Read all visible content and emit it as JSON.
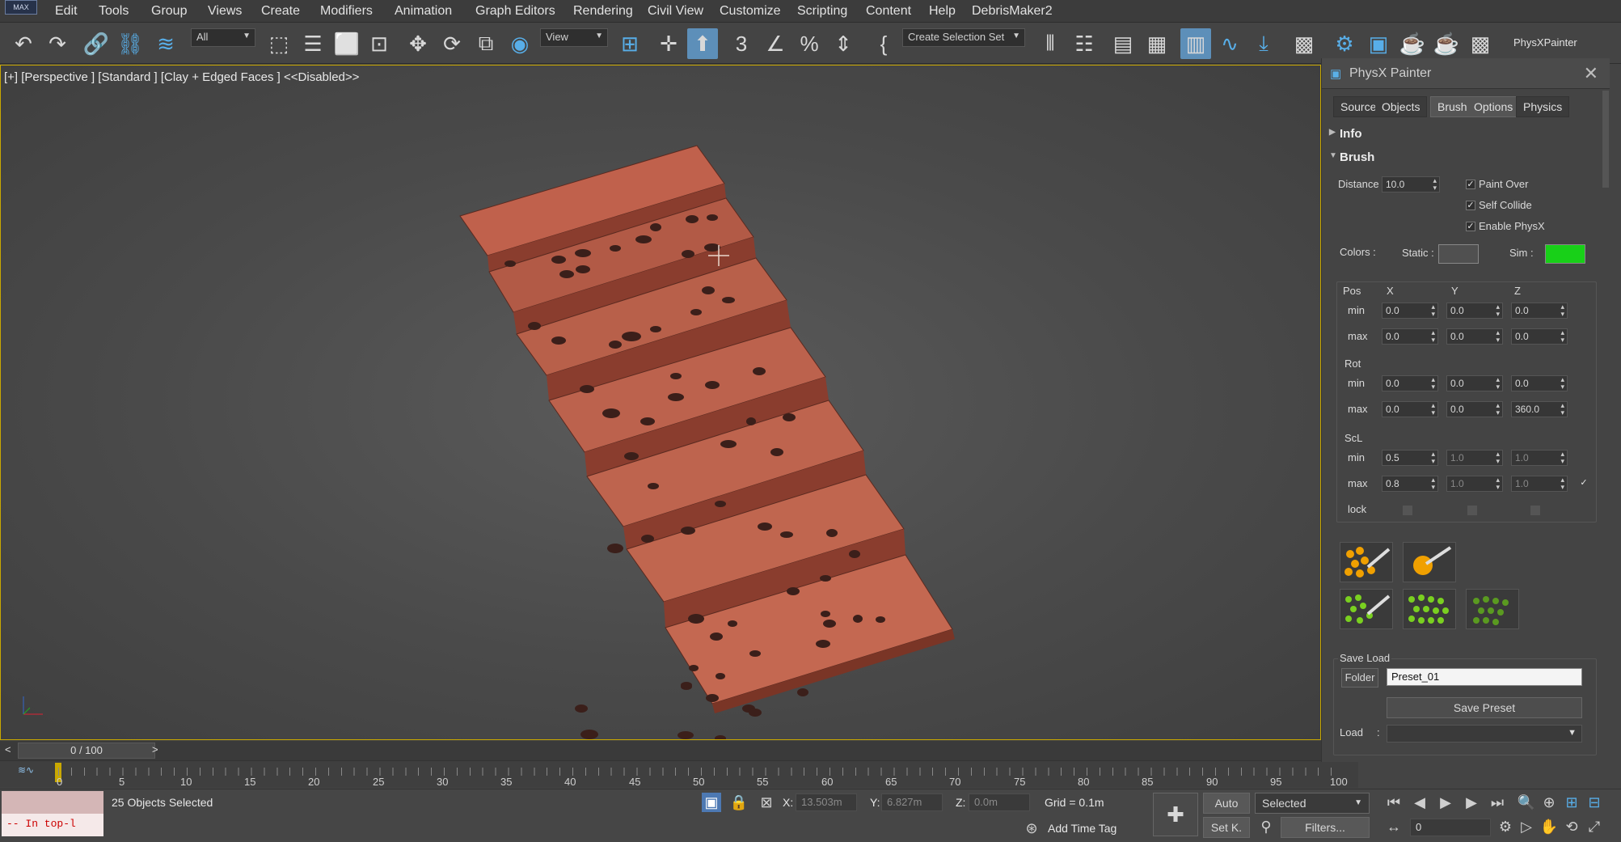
{
  "app": {
    "logo": "MAX"
  },
  "menu": [
    "Edit",
    "Tools",
    "Group",
    "Views",
    "Create",
    "Modifiers",
    "Animation",
    "Graph Editors",
    "Rendering",
    "Civil View",
    "Customize",
    "Scripting",
    "Content",
    "Help",
    "DebrisMaker2"
  ],
  "toolbar": {
    "filter": "All",
    "refcoord": "View",
    "selection_set": "Create Selection Set",
    "plugin_label": "PhysXPainter"
  },
  "viewport": {
    "label": "[+] [Perspective ] [Standard ] [Clay + Edged Faces ] <<Disabled>>"
  },
  "panel": {
    "title": "PhysX Painter",
    "tabs": [
      "Source",
      "Objects",
      "Brush",
      "Options",
      "Physics"
    ],
    "rollouts": {
      "info": "Info",
      "brush": "Brush"
    },
    "distance": {
      "label": "Distance",
      "value": "10.0"
    },
    "checks": [
      {
        "label": "Paint Over",
        "checked": true
      },
      {
        "label": "Self Collide",
        "checked": true
      },
      {
        "label": "Enable PhysX",
        "checked": true
      }
    ],
    "colors": {
      "label": "Colors :",
      "static_label": "Static :",
      "sim_label": "Sim :",
      "static_color": "#505050",
      "sim_color": "#18d018"
    },
    "axes": [
      "X",
      "Y",
      "Z"
    ],
    "groups": {
      "pos": "Pos",
      "rot": "Rot",
      "scl": "ScL"
    },
    "minmax": {
      "min": "min",
      "max": "max",
      "lock": "lock"
    },
    "pos": {
      "min": [
        "0.0",
        "0.0",
        "0.0"
      ],
      "max": [
        "0.0",
        "0.0",
        "0.0"
      ]
    },
    "rot": {
      "min": [
        "0.0",
        "0.0",
        "0.0"
      ],
      "max": [
        "0.0",
        "0.0",
        "360.0"
      ]
    },
    "scl": {
      "min": [
        "0.5",
        "1.0",
        "1.0"
      ],
      "max": [
        "0.8",
        "1.0",
        "1.0"
      ]
    },
    "saveload": {
      "title": "Save Load",
      "folder_btn": "Folder",
      "preset": "Preset_01",
      "save_btn": "Save Preset",
      "load_label": "Load",
      ":": ":"
    }
  },
  "time": {
    "slider": "0 / 100",
    "prev": "<",
    "next": ">",
    "ticks": [
      "0",
      "5",
      "10",
      "15",
      "20",
      "25",
      "30",
      "35",
      "40",
      "45",
      "50",
      "55",
      "60",
      "65",
      "70",
      "75",
      "80",
      "85",
      "90",
      "95",
      "100"
    ]
  },
  "status": {
    "maxscript": "-- In top-l",
    "selected": "25 Objects Selected",
    "x_label": "X:",
    "x": "13.503m",
    "y_label": "Y:",
    "y": "6.827m",
    "z_label": "Z:",
    "z": "0.0m",
    "grid": "Grid = 0.1m",
    "add_time_tag": "Add Time Tag",
    "auto": "Auto",
    "selected_dd": "Selected",
    "setk": "Set K.",
    "filters": "Filters...",
    "frame": "0"
  }
}
